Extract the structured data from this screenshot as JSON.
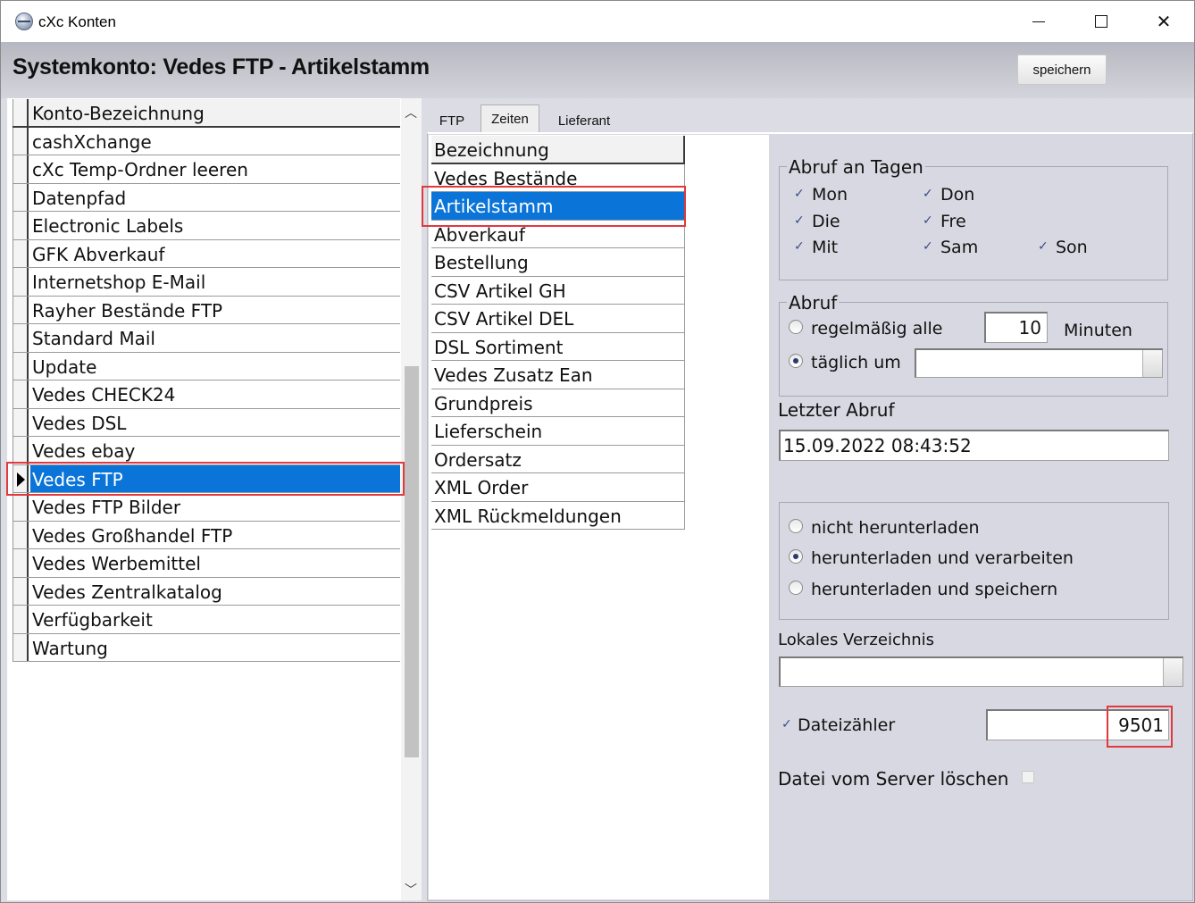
{
  "window": {
    "title": "cXc Konten"
  },
  "header": {
    "title": "Systemkonto: Vedes FTP - Artikelstamm",
    "save_label": "speichern"
  },
  "left_list": {
    "header": "Konto-Bezeichnung",
    "items": [
      "cashXchange",
      "cXc Temp-Ordner leeren",
      "Datenpfad",
      "Electronic Labels",
      "GFK Abverkauf",
      "Internetshop E-Mail",
      "Rayher Bestände FTP",
      "Standard Mail",
      "Update",
      "Vedes CHECK24",
      "Vedes DSL",
      "Vedes ebay",
      "Vedes FTP",
      "Vedes FTP Bilder",
      "Vedes Großhandel FTP",
      "Vedes Werbemittel",
      "Vedes Zentralkatalog",
      "Verfügbarkeit",
      "Wartung"
    ],
    "selected": "Vedes FTP"
  },
  "tabs": {
    "ftp": "FTP",
    "zeiten": "Zeiten",
    "lieferant": "Lieferant",
    "active": "Zeiten"
  },
  "mid_list": {
    "header": "Bezeichnung",
    "items": [
      "Vedes Bestände",
      "Artikelstamm",
      "Abverkauf",
      "Bestellung",
      "CSV Artikel GH",
      "CSV Artikel DEL",
      "DSL Sortiment",
      "Vedes Zusatz Ean",
      "Grundpreis",
      "Lieferschein",
      "Ordersatz",
      "XML Order",
      "XML Rückmeldungen"
    ],
    "selected": "Artikelstamm"
  },
  "abruf_tage": {
    "title": "Abruf an Tagen",
    "days": {
      "mon": "Mon",
      "die": "Die",
      "mit": "Mit",
      "don": "Don",
      "fre": "Fre",
      "sam": "Sam",
      "son": "Son"
    },
    "check_mark": "✓"
  },
  "abruf": {
    "title": "Abruf",
    "regelmaessig_label": "regelmäßig alle",
    "interval_value": "10",
    "minuten_label": "Minuten",
    "taeglich_label": "täglich um",
    "taeglich_value": "",
    "selected": "täglich um"
  },
  "letzter_abruf": {
    "label": "Letzter Abruf",
    "value": "15.09.2022 08:43:52"
  },
  "download": {
    "options": [
      "nicht herunterladen",
      "herunterladen und verarbeiten",
      "herunterladen und speichern"
    ],
    "selected": "herunterladen und verarbeiten"
  },
  "lokales_verzeichnis": {
    "label": "Lokales Verzeichnis",
    "value": ""
  },
  "dateizaehler": {
    "label": "Dateizähler",
    "checked": true,
    "value": "9501"
  },
  "datei_loeschen": {
    "label": "Datei vom Server löschen",
    "checked": false
  },
  "colors": {
    "selection": "#0a74d8",
    "highlight_box": "#e0393e",
    "panel_bg": "#d8d8e2"
  }
}
